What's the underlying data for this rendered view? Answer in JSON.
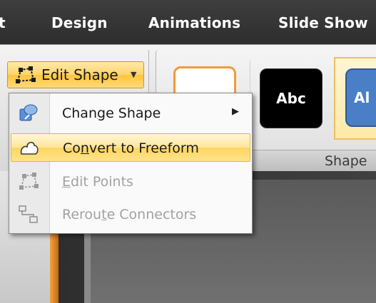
{
  "ribbon": {
    "tabs": [
      {
        "label": "t"
      },
      {
        "label": "Design"
      },
      {
        "label": "Animations"
      },
      {
        "label": "Slide Show"
      }
    ],
    "shape_styles_label": "Shape",
    "style_swatches": [
      "",
      "Abc",
      "Al"
    ]
  },
  "edit_shape": {
    "label": "Edit Shape",
    "icon": "edit-shape-icon"
  },
  "menu": {
    "items": [
      {
        "label_pre": "Chan",
        "label_u": "g",
        "label_post": "e Shape",
        "icon": "change-shape-icon",
        "disabled": false,
        "submenu": true,
        "highlighted": false
      },
      {
        "label_pre": "Co",
        "label_u": "n",
        "label_post": "vert to Freeform",
        "icon": "freeform-icon",
        "disabled": false,
        "submenu": false,
        "highlighted": true
      },
      {
        "label_pre": "",
        "label_u": "E",
        "label_post": "dit Points",
        "icon": "edit-points-icon",
        "disabled": true,
        "submenu": false,
        "highlighted": false
      },
      {
        "label_pre": "Rerou",
        "label_u": "t",
        "label_post": "e Connectors",
        "icon": "reroute-connectors-icon",
        "disabled": true,
        "submenu": false,
        "highlighted": false
      }
    ],
    "submenu_arrow": "▶"
  },
  "colors": {
    "highlight": "#ffd560",
    "accent_orange": "#f29a3a",
    "style_blue": "#4a7fc8"
  }
}
